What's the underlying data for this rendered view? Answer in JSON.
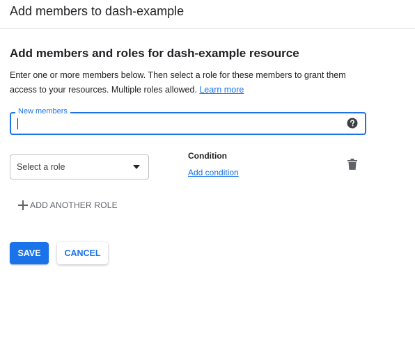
{
  "header": {
    "title": "Add members to dash-example"
  },
  "section": {
    "title": "Add members and roles for dash-example resource",
    "description": "Enter one or more members below. Then select a role for these members to grant them access to your resources. Multiple roles allowed. ",
    "learn_more": "Learn more"
  },
  "members": {
    "label": "New members",
    "value": "",
    "help_icon": "help-circle-icon"
  },
  "role": {
    "placeholder": "Select a role",
    "dropdown_icon": "arrow-drop-down-icon"
  },
  "condition": {
    "title": "Condition",
    "add_label": "Add condition"
  },
  "delete_icon": "trash-icon",
  "add_role": {
    "label": "ADD ANOTHER ROLE",
    "icon": "plus-icon"
  },
  "actions": {
    "save": "SAVE",
    "cancel": "CANCEL"
  },
  "colors": {
    "accent": "#1a73e8",
    "text": "#202124",
    "muted": "#5f6368",
    "border": "#dadce0"
  }
}
